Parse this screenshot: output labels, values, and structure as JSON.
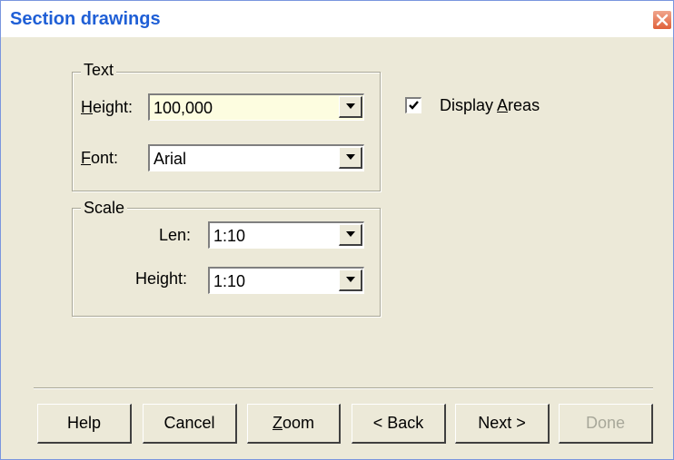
{
  "window": {
    "title": "Section drawings"
  },
  "text_group": {
    "label": "Text",
    "height_label_underlined": "H",
    "height_label_rest": "eight:",
    "height_value": "100,000",
    "font_label_underlined": "F",
    "font_label_rest": "ont:",
    "font_value": "Arial"
  },
  "scale_group": {
    "label": "Scale",
    "len_label": "Len:",
    "len_value": "1:10",
    "height_label": "Height:",
    "height_value": "1:10"
  },
  "display_areas": {
    "checked": true,
    "label_prefix": "Display ",
    "label_underlined": "A",
    "label_rest": "reas"
  },
  "buttons": {
    "help": "Help",
    "cancel": "Cancel",
    "zoom_underlined": "Z",
    "zoom_rest": "oom",
    "back": "< Back",
    "next": "Next >",
    "done": "Done",
    "done_enabled": false
  },
  "icons": {
    "close": "close-icon",
    "dropdown": "chevron-down-icon",
    "check": "check-icon"
  },
  "colors": {
    "title_text": "#1f5fd6",
    "face": "#ece9d8",
    "close_button": "#e0603a",
    "field_highlight": "#fdfde0"
  }
}
